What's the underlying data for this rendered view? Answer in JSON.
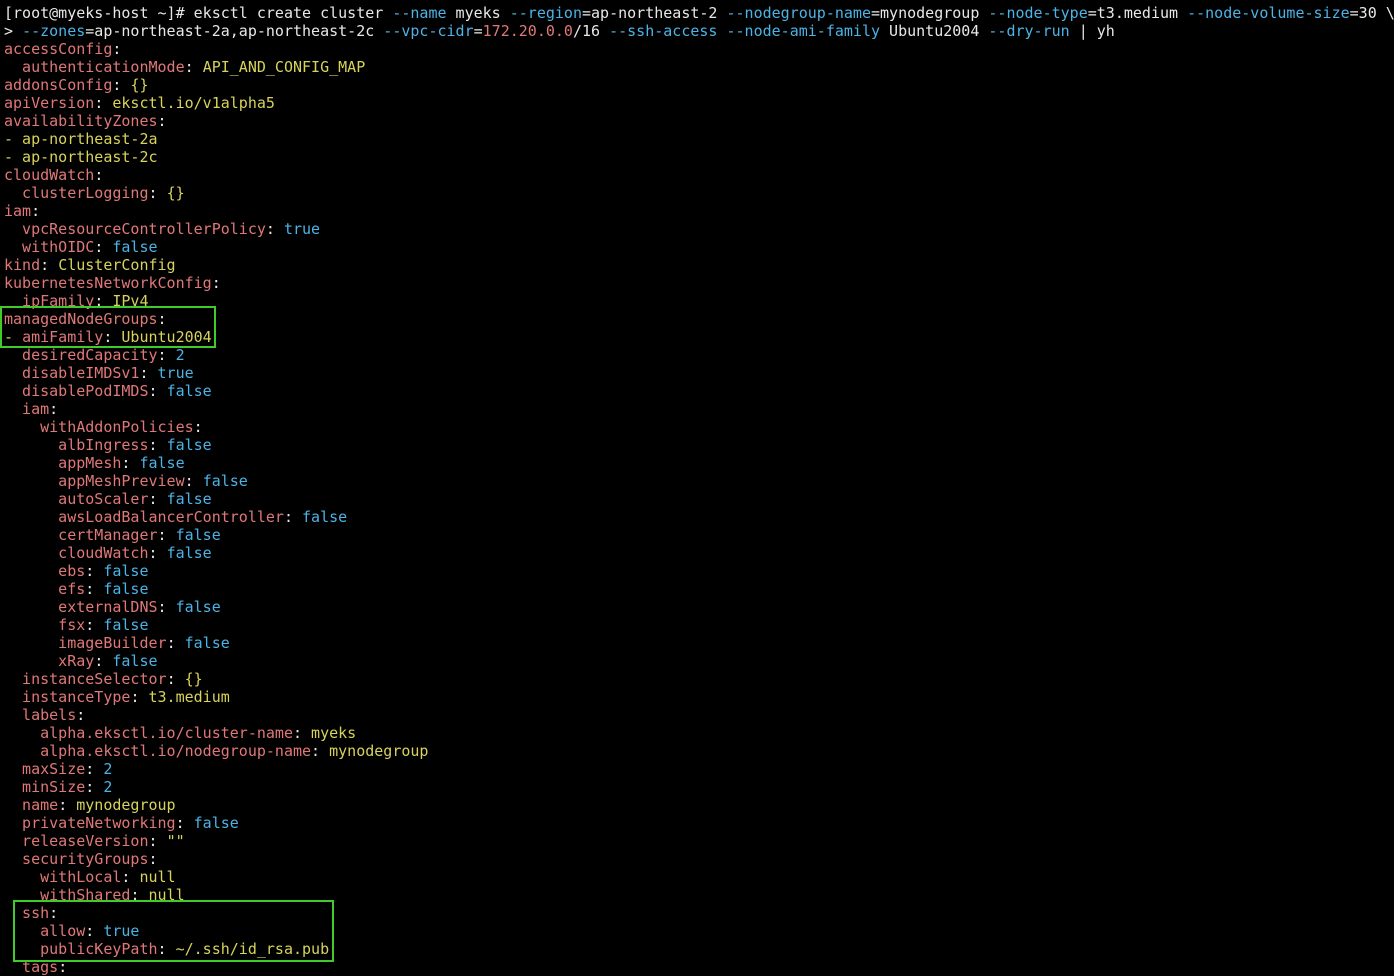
{
  "colors": {
    "background": "#000000",
    "plain": "#e8e8e8",
    "key": "#e07878",
    "string_value": "#d8d35a",
    "flag_literal": "#4cb3e6",
    "highlight_box": "#3fcc2b"
  },
  "lines": [
    [
      {
        "t": "[root@myeks-host ~]# eksctl create cluster ",
        "c": "p"
      },
      {
        "t": "--name",
        "c": "b"
      },
      {
        "t": " myeks ",
        "c": "p"
      },
      {
        "t": "--region",
        "c": "b"
      },
      {
        "t": "=ap-northeast-2 ",
        "c": "p"
      },
      {
        "t": "--nodegroup-name",
        "c": "b"
      },
      {
        "t": "=mynodegroup ",
        "c": "p"
      },
      {
        "t": "--node-type",
        "c": "b"
      },
      {
        "t": "=t3.medium ",
        "c": "p"
      },
      {
        "t": "--node-volume-size",
        "c": "b"
      },
      {
        "t": "=30 \\",
        "c": "p"
      }
    ],
    [
      {
        "t": "> ",
        "c": "p"
      },
      {
        "t": "--zones",
        "c": "b"
      },
      {
        "t": "=ap-northeast-2a,ap-northeast-2c ",
        "c": "p"
      },
      {
        "t": "--vpc-cidr",
        "c": "b"
      },
      {
        "t": "=",
        "c": "p"
      },
      {
        "t": "172.20.0.0",
        "c": "k"
      },
      {
        "t": "/16 ",
        "c": "p"
      },
      {
        "t": "--ssh-access",
        "c": "b"
      },
      {
        "t": " ",
        "c": "p"
      },
      {
        "t": "--node-ami-family",
        "c": "b"
      },
      {
        "t": " Ubuntu2004 ",
        "c": "p"
      },
      {
        "t": "--dry-run",
        "c": "b"
      },
      {
        "t": " | yh",
        "c": "p"
      }
    ],
    [
      {
        "t": "accessConfig",
        "c": "k"
      },
      {
        "t": ":",
        "c": "p"
      }
    ],
    [
      {
        "t": "  authenticationMode",
        "c": "k"
      },
      {
        "t": ": ",
        "c": "p"
      },
      {
        "t": "API_AND_CONFIG_MAP",
        "c": "v"
      }
    ],
    [
      {
        "t": "addonsConfig",
        "c": "k"
      },
      {
        "t": ": ",
        "c": "p"
      },
      {
        "t": "{}",
        "c": "v"
      }
    ],
    [
      {
        "t": "apiVersion",
        "c": "k"
      },
      {
        "t": ": ",
        "c": "p"
      },
      {
        "t": "eksctl.io/v1alpha5",
        "c": "v"
      }
    ],
    [
      {
        "t": "availabilityZones",
        "c": "k"
      },
      {
        "t": ":",
        "c": "p"
      }
    ],
    [
      {
        "t": "- ap-northeast-2a",
        "c": "v"
      }
    ],
    [
      {
        "t": "- ap-northeast-2c",
        "c": "v"
      }
    ],
    [
      {
        "t": "cloudWatch",
        "c": "k"
      },
      {
        "t": ":",
        "c": "p"
      }
    ],
    [
      {
        "t": "  clusterLogging",
        "c": "k"
      },
      {
        "t": ": ",
        "c": "p"
      },
      {
        "t": "{}",
        "c": "v"
      }
    ],
    [
      {
        "t": "iam",
        "c": "k"
      },
      {
        "t": ":",
        "c": "p"
      }
    ],
    [
      {
        "t": "  vpcResourceControllerPolicy",
        "c": "k"
      },
      {
        "t": ": ",
        "c": "p"
      },
      {
        "t": "true",
        "c": "b"
      }
    ],
    [
      {
        "t": "  withOIDC",
        "c": "k"
      },
      {
        "t": ": ",
        "c": "p"
      },
      {
        "t": "false",
        "c": "b"
      }
    ],
    [
      {
        "t": "kind",
        "c": "k"
      },
      {
        "t": ": ",
        "c": "p"
      },
      {
        "t": "ClusterConfig",
        "c": "v"
      }
    ],
    [
      {
        "t": "kubernetesNetworkConfig",
        "c": "k"
      },
      {
        "t": ":",
        "c": "p"
      }
    ],
    [
      {
        "t": "  ipFamily",
        "c": "k"
      },
      {
        "t": ": ",
        "c": "p"
      },
      {
        "t": "IPv4",
        "c": "v"
      }
    ],
    [
      {
        "t": "managedNodeGroups",
        "c": "k"
      },
      {
        "t": ":",
        "c": "p"
      }
    ],
    [
      {
        "t": "- ",
        "c": "v"
      },
      {
        "t": "amiFamily",
        "c": "k"
      },
      {
        "t": ": ",
        "c": "p"
      },
      {
        "t": "Ubuntu2004",
        "c": "v"
      }
    ],
    [
      {
        "t": "  desiredCapacity",
        "c": "k"
      },
      {
        "t": ": ",
        "c": "p"
      },
      {
        "t": "2",
        "c": "b"
      }
    ],
    [
      {
        "t": "  disableIMDSv1",
        "c": "k"
      },
      {
        "t": ": ",
        "c": "p"
      },
      {
        "t": "true",
        "c": "b"
      }
    ],
    [
      {
        "t": "  disablePodIMDS",
        "c": "k"
      },
      {
        "t": ": ",
        "c": "p"
      },
      {
        "t": "false",
        "c": "b"
      }
    ],
    [
      {
        "t": "  iam",
        "c": "k"
      },
      {
        "t": ":",
        "c": "p"
      }
    ],
    [
      {
        "t": "    withAddonPolicies",
        "c": "k"
      },
      {
        "t": ":",
        "c": "p"
      }
    ],
    [
      {
        "t": "      albIngress",
        "c": "k"
      },
      {
        "t": ": ",
        "c": "p"
      },
      {
        "t": "false",
        "c": "b"
      }
    ],
    [
      {
        "t": "      appMesh",
        "c": "k"
      },
      {
        "t": ": ",
        "c": "p"
      },
      {
        "t": "false",
        "c": "b"
      }
    ],
    [
      {
        "t": "      appMeshPreview",
        "c": "k"
      },
      {
        "t": ": ",
        "c": "p"
      },
      {
        "t": "false",
        "c": "b"
      }
    ],
    [
      {
        "t": "      autoScaler",
        "c": "k"
      },
      {
        "t": ": ",
        "c": "p"
      },
      {
        "t": "false",
        "c": "b"
      }
    ],
    [
      {
        "t": "      awsLoadBalancerController",
        "c": "k"
      },
      {
        "t": ": ",
        "c": "p"
      },
      {
        "t": "false",
        "c": "b"
      }
    ],
    [
      {
        "t": "      certManager",
        "c": "k"
      },
      {
        "t": ": ",
        "c": "p"
      },
      {
        "t": "false",
        "c": "b"
      }
    ],
    [
      {
        "t": "      cloudWatch",
        "c": "k"
      },
      {
        "t": ": ",
        "c": "p"
      },
      {
        "t": "false",
        "c": "b"
      }
    ],
    [
      {
        "t": "      ebs",
        "c": "k"
      },
      {
        "t": ": ",
        "c": "p"
      },
      {
        "t": "false",
        "c": "b"
      }
    ],
    [
      {
        "t": "      efs",
        "c": "k"
      },
      {
        "t": ": ",
        "c": "p"
      },
      {
        "t": "false",
        "c": "b"
      }
    ],
    [
      {
        "t": "      externalDNS",
        "c": "k"
      },
      {
        "t": ": ",
        "c": "p"
      },
      {
        "t": "false",
        "c": "b"
      }
    ],
    [
      {
        "t": "      fsx",
        "c": "k"
      },
      {
        "t": ": ",
        "c": "p"
      },
      {
        "t": "false",
        "c": "b"
      }
    ],
    [
      {
        "t": "      imageBuilder",
        "c": "k"
      },
      {
        "t": ": ",
        "c": "p"
      },
      {
        "t": "false",
        "c": "b"
      }
    ],
    [
      {
        "t": "      xRay",
        "c": "k"
      },
      {
        "t": ": ",
        "c": "p"
      },
      {
        "t": "false",
        "c": "b"
      }
    ],
    [
      {
        "t": "  instanceSelector",
        "c": "k"
      },
      {
        "t": ": ",
        "c": "p"
      },
      {
        "t": "{}",
        "c": "v"
      }
    ],
    [
      {
        "t": "  instanceType",
        "c": "k"
      },
      {
        "t": ": ",
        "c": "p"
      },
      {
        "t": "t3.medium",
        "c": "v"
      }
    ],
    [
      {
        "t": "  labels",
        "c": "k"
      },
      {
        "t": ":",
        "c": "p"
      }
    ],
    [
      {
        "t": "    alpha.eksctl.io/cluster-name",
        "c": "k"
      },
      {
        "t": ": ",
        "c": "p"
      },
      {
        "t": "myeks",
        "c": "v"
      }
    ],
    [
      {
        "t": "    alpha.eksctl.io/nodegroup-name",
        "c": "k"
      },
      {
        "t": ": ",
        "c": "p"
      },
      {
        "t": "mynodegroup",
        "c": "v"
      }
    ],
    [
      {
        "t": "  maxSize",
        "c": "k"
      },
      {
        "t": ": ",
        "c": "p"
      },
      {
        "t": "2",
        "c": "b"
      }
    ],
    [
      {
        "t": "  minSize",
        "c": "k"
      },
      {
        "t": ": ",
        "c": "p"
      },
      {
        "t": "2",
        "c": "b"
      }
    ],
    [
      {
        "t": "  name",
        "c": "k"
      },
      {
        "t": ": ",
        "c": "p"
      },
      {
        "t": "mynodegroup",
        "c": "v"
      }
    ],
    [
      {
        "t": "  privateNetworking",
        "c": "k"
      },
      {
        "t": ": ",
        "c": "p"
      },
      {
        "t": "false",
        "c": "b"
      }
    ],
    [
      {
        "t": "  releaseVersion",
        "c": "k"
      },
      {
        "t": ": ",
        "c": "p"
      },
      {
        "t": "\"\"",
        "c": "v"
      }
    ],
    [
      {
        "t": "  securityGroups",
        "c": "k"
      },
      {
        "t": ":",
        "c": "p"
      }
    ],
    [
      {
        "t": "    withLocal",
        "c": "k"
      },
      {
        "t": ": ",
        "c": "p"
      },
      {
        "t": "null",
        "c": "v"
      }
    ],
    [
      {
        "t": "    withShared",
        "c": "k"
      },
      {
        "t": ": ",
        "c": "p"
      },
      {
        "t": "null",
        "c": "v"
      }
    ],
    [
      {
        "t": "  ssh",
        "c": "k"
      },
      {
        "t": ":",
        "c": "p"
      }
    ],
    [
      {
        "t": "    allow",
        "c": "k"
      },
      {
        "t": ": ",
        "c": "p"
      },
      {
        "t": "true",
        "c": "b"
      }
    ],
    [
      {
        "t": "    publicKeyPath",
        "c": "k"
      },
      {
        "t": ": ",
        "c": "p"
      },
      {
        "t": "~/.ssh/id_rsa.pub",
        "c": "v"
      }
    ],
    [
      {
        "t": "  tags",
        "c": "k"
      },
      {
        "t": ":",
        "c": "p"
      }
    ]
  ]
}
